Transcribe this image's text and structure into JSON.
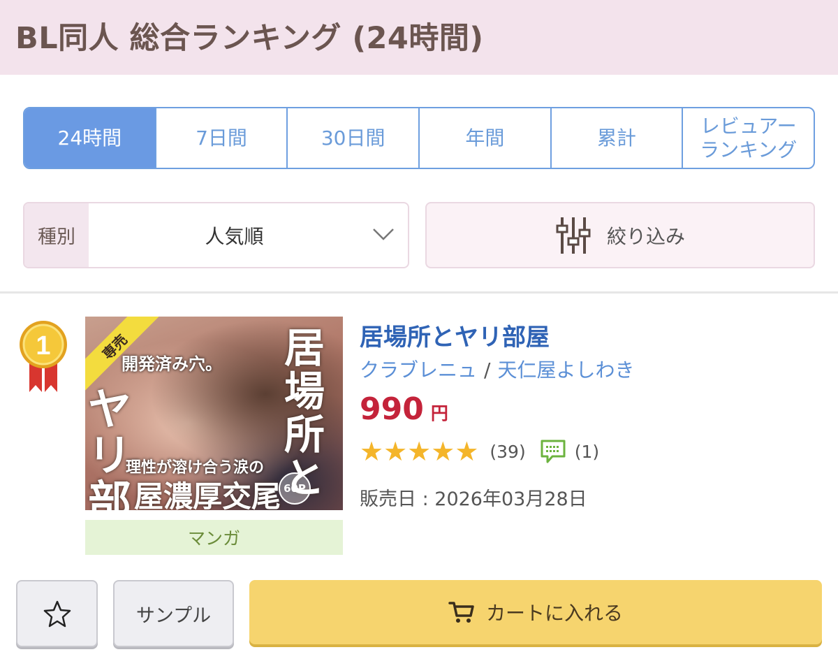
{
  "header": {
    "title": "BL同人 総合ランキング (24時間)"
  },
  "tabs": [
    {
      "label": "24時間",
      "active": true
    },
    {
      "label": "7日間",
      "active": false
    },
    {
      "label": "30日間",
      "active": false
    },
    {
      "label": "年間",
      "active": false
    },
    {
      "label": "累計",
      "active": false
    },
    {
      "label": "レビュアー\nランキング",
      "active": false
    }
  ],
  "sort": {
    "label": "種別",
    "value": "人気順",
    "icon": "chevron-down-icon"
  },
  "filter": {
    "label": "絞り込み",
    "icon": "sliders-icon"
  },
  "item": {
    "rank": "1",
    "title": "居場所とヤリ部屋",
    "circle": "クラブレニュ",
    "author_separator": "/",
    "author": "天仁屋よしわき",
    "price": "990",
    "currency": "円",
    "rating_stars": 5,
    "review_count": "(39)",
    "comment_count": "(1)",
    "release_date": "販売日 : 2026年03月28日",
    "genre": "マンガ",
    "cover": {
      "badge": "専売",
      "tagline": "開発済み穴。",
      "title_vertical_right": "居場所と",
      "title_vertical_left": "ヤリ部",
      "subtitle": "理性が溶け合う涙の",
      "bottom_text": "屋濃厚交尾",
      "pages": "60P"
    }
  },
  "actions": {
    "favorite_icon": "star-outline-icon",
    "sample_label": "サンプル",
    "cart_label": "カートに入れる",
    "cart_icon": "cart-icon"
  },
  "colors": {
    "header_bg": "#f3e3ec",
    "tab_active": "#6a9ae3",
    "link_blue": "#2f63b5",
    "price_red": "#c4233a",
    "star": "#f4b52a",
    "cart_button": "#f6d46e"
  }
}
